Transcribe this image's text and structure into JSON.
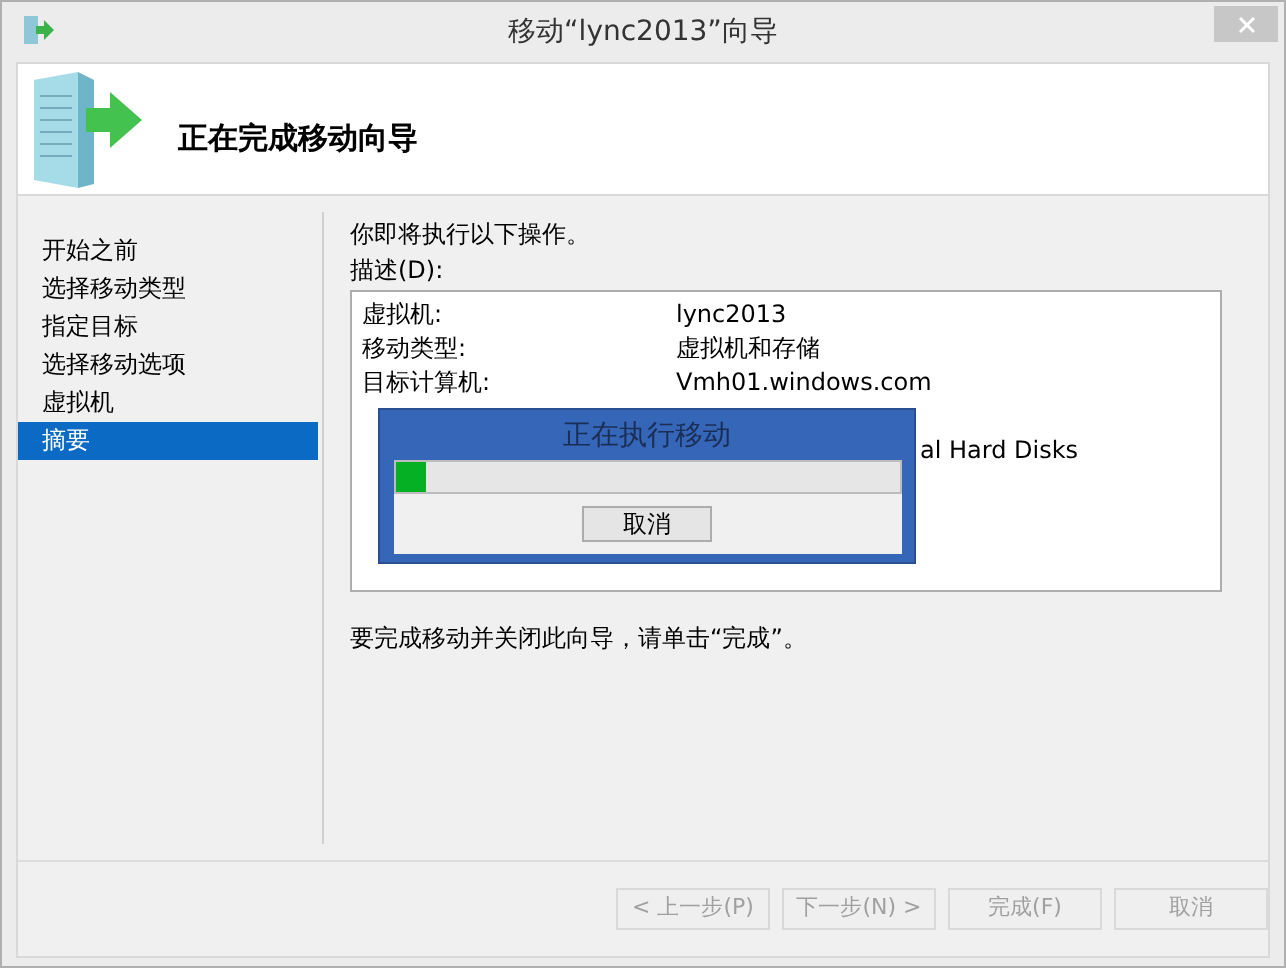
{
  "window": {
    "title": "移动“lync2013”向导"
  },
  "header": {
    "title": "正在完成移动向导"
  },
  "sidebar": {
    "items": [
      {
        "label": "开始之前",
        "selected": false
      },
      {
        "label": "选择移动类型",
        "selected": false
      },
      {
        "label": "指定目标",
        "selected": false
      },
      {
        "label": "选择移动选项",
        "selected": false
      },
      {
        "label": "虚拟机",
        "selected": false
      },
      {
        "label": "摘要",
        "selected": true
      }
    ]
  },
  "intro": "你即将执行以下操作。",
  "description_label": "描述(D):",
  "summary_rows": [
    {
      "label": "虚拟机:",
      "value": "lync2013"
    },
    {
      "label": "移动类型:",
      "value": "虚拟机和存储"
    },
    {
      "label": "目标计算机:",
      "value": "Vmh01.windows.com"
    },
    {
      "label": "",
      "value": ""
    },
    {
      "label": "",
      "value": "al Hard Disks"
    }
  ],
  "footer_note": "要完成移动并关闭此向导，请单击“完成”。",
  "buttons": [
    {
      "label": "< 上一步(P)",
      "disabled": true
    },
    {
      "label": "下一步(N) >",
      "disabled": true
    },
    {
      "label": "完成(F)",
      "disabled": true
    },
    {
      "label": "取消",
      "disabled": true
    }
  ],
  "progress_dialog": {
    "title": "正在执行移动",
    "level": 0.06,
    "cancel": "取消"
  }
}
